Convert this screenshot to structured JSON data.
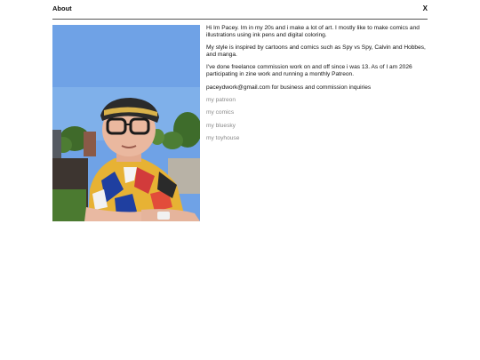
{
  "header": {
    "title": "About",
    "close_label": "X"
  },
  "photo": {
    "icon": "profile-photo"
  },
  "bio": {
    "paragraphs": [
      "Hi Im Pacey. Im in my 20s and i make a lot of art. I mostly like to make comics and illustrations using ink pens and digital coloring.",
      "My style is inspired by cartoons and comics such as Spy vs Spy, Calvin and Hobbes, and manga.",
      "I've done freelance commission work on and off since i was 13. As of I am 2026 participating in zine work and running a monthly Patreon.",
      "paceydwork@gmail.com for business and commission inquiries"
    ]
  },
  "links": [
    {
      "label": "my patreon"
    },
    {
      "label": "my comics"
    },
    {
      "label": "my bluesky"
    },
    {
      "label": "my toyhouse"
    }
  ],
  "colors": {
    "link": "#8a8a8a",
    "divider": "#555555",
    "sky": "#6fa2e6"
  }
}
